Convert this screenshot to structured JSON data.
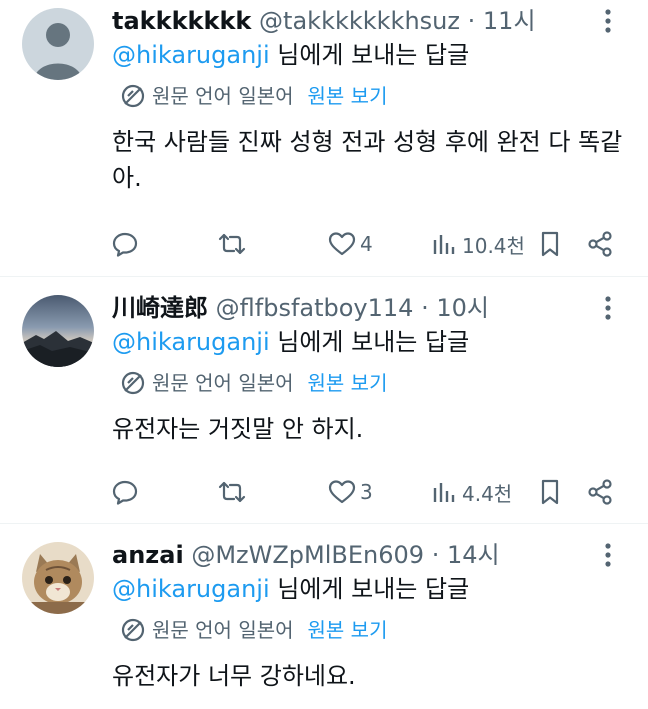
{
  "replies": [
    {
      "name": "takkkkkkk",
      "handle": "@takkkkkkkhsuz",
      "separator": "·",
      "time": "11시",
      "reply_mention": "@hikaruganji",
      "reply_suffix": " 님에게 보내는 답글",
      "original_language": "원문 언어 일본어",
      "show_original": "원본 보기",
      "text": "한국 사람들 진짜 성형 전과 성형 후에 완전 다 똑같아.",
      "likes": "4",
      "views": "10.4천",
      "avatar": "default-avatar"
    },
    {
      "name": "川崎達郎",
      "handle": "@flfbsfatboy114",
      "separator": "·",
      "time": "10시",
      "reply_mention": "@hikaruganji",
      "reply_suffix": " 님에게 보내는 답글",
      "original_language": "원문 언어 일본어",
      "show_original": "원본 보기",
      "text": "유전자는 거짓말 안 하지.",
      "likes": "3",
      "views": "4.4천",
      "avatar": "landscape-avatar"
    },
    {
      "name": "anzai",
      "handle": "@MzWZpMlBEn609",
      "separator": "·",
      "time": "14시",
      "reply_mention": "@hikaruganji",
      "reply_suffix": " 님에게 보내는 답글",
      "original_language": "원문 언어 일본어",
      "show_original": "원본 보기",
      "text": "유전자가 너무 강하네요.",
      "avatar": "cat-avatar"
    }
  ],
  "icons": {
    "reply": "reply-icon",
    "retweet": "retweet-icon",
    "like": "heart-icon",
    "views": "views-icon",
    "bookmark": "bookmark-icon",
    "share": "share-icon",
    "more": "more-icon",
    "translate": "translate-icon"
  },
  "colors": {
    "accent": "#1d9bf0",
    "secondary_text": "#536471",
    "primary_text": "#0f1419",
    "divider": "#eff3f4"
  }
}
